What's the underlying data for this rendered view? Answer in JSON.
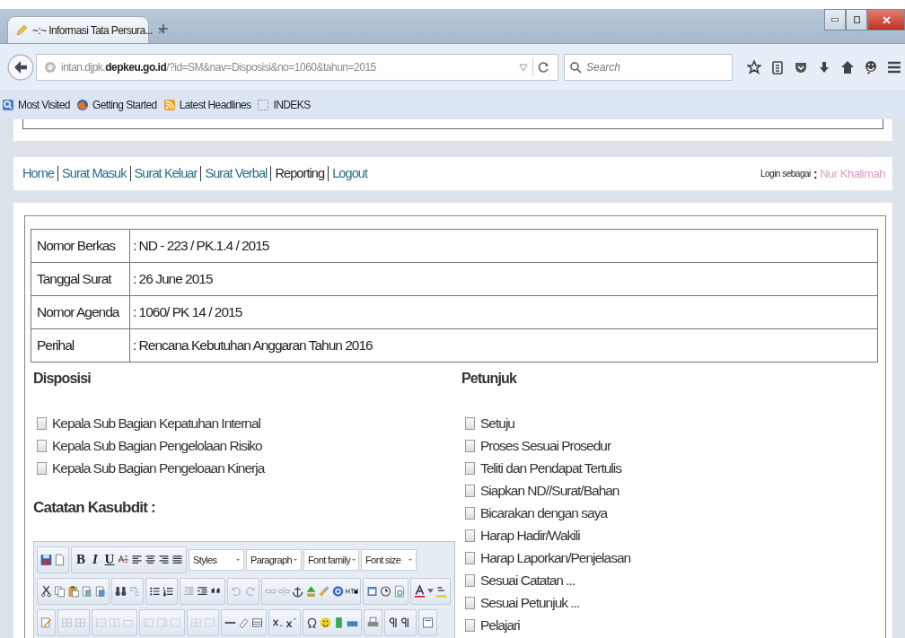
{
  "browser": {
    "tab": {
      "title": "~:~ Informasi Tata Persura..."
    },
    "url": "intan.djpk.**depkeu.go.id**/?id=SM&nav=Disposisi&no=1060&tahun=2015",
    "search": {
      "placeholder": "Search"
    },
    "bookmarks": [
      {
        "label": "Most Visited",
        "kind": "search"
      },
      {
        "label": "Getting Started",
        "kind": "globe"
      },
      {
        "label": "Latest Headlines",
        "kind": "feed"
      },
      {
        "label": "INDEKS",
        "kind": "blank"
      }
    ]
  },
  "nav": {
    "links": [
      {
        "label": "Home",
        "color": "#2b6c86"
      },
      {
        "label": "Surat Masuk",
        "color": "#2b6c86"
      },
      {
        "label": "Surat Keluar",
        "color": "#2b6c86"
      },
      {
        "label": "Surat Verbal",
        "color": "#2b6c86"
      },
      {
        "label": "Reporting",
        "color": "#222222"
      },
      {
        "label": "Logout",
        "color": "#2b6c86"
      }
    ],
    "login_label": "Login sebagai",
    "login_sep": ":",
    "user": "Nur Khalimah"
  },
  "details": [
    {
      "label": "Nomor Berkas",
      "value": ": ND - 223 / PK.1.4 / 2015"
    },
    {
      "label": "Tanggal Surat",
      "value": ": 26 June 2015"
    },
    {
      "label": "Nomor Agenda",
      "value": ": 1060/ PK 14 / 2015"
    },
    {
      "label": "Perihal",
      "value": ": Rencana Kebutuhan Anggaran Tahun 2016"
    }
  ],
  "disposisi": {
    "title": "Disposisi",
    "options": [
      {
        "label": "Kepala Sub Bagian Kepatuhan Internal",
        "checked": false
      },
      {
        "label": "Kepala Sub Bagian Pengelolaan Risiko",
        "checked": false
      },
      {
        "label": "Kepala Sub Bagian Pengeloaan Kinerja",
        "checked": false
      }
    ]
  },
  "notes": {
    "title": "Catatan Kasubdit :"
  },
  "editor": {
    "format_buttons": [
      {
        "label": "B",
        "kind": "bold"
      },
      {
        "label": "I",
        "kind": "italic"
      },
      {
        "label": "U",
        "kind": "underline"
      }
    ],
    "dropdowns": [
      "Styles",
      "Paragraph",
      "Font family",
      "Font size"
    ]
  },
  "petunjuk": {
    "title": "Petunjuk",
    "options": [
      {
        "label": "Setuju",
        "checked": false
      },
      {
        "label": "Proses Sesuai Prosedur",
        "checked": false
      },
      {
        "label": "Teliti dan Pendapat Tertulis",
        "checked": false
      },
      {
        "label": "Siapkan ND//Surat/Bahan",
        "checked": false
      },
      {
        "label": "Bicarakan dengan saya",
        "checked": false
      },
      {
        "label": "Harap Hadir/Wakili",
        "checked": false
      },
      {
        "label": "Harap Laporkan/Penjelasan",
        "checked": false
      },
      {
        "label": "Sesuai Catatan ...",
        "checked": false
      },
      {
        "label": "Sesuai Petunjuk ...",
        "checked": false
      },
      {
        "label": "Pelajari",
        "checked": false
      }
    ]
  }
}
